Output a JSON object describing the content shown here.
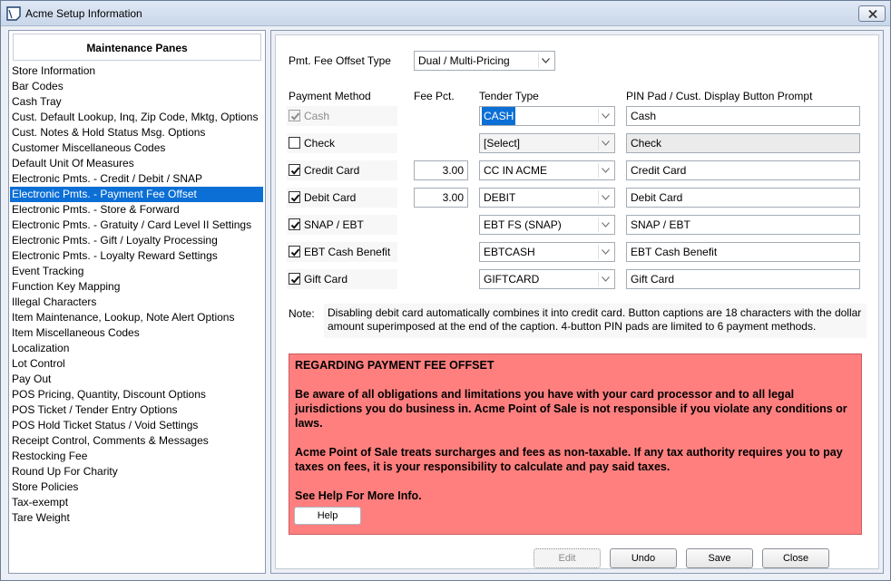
{
  "window": {
    "title": "Acme Setup Information"
  },
  "left_panel": {
    "header": "Maintenance Panes",
    "items": [
      "Store Information",
      "Bar Codes",
      "Cash Tray",
      "Cust. Default Lookup, Inq, Zip Code, Mktg, Options",
      "Cust. Notes & Hold Status Msg. Options",
      "Customer Miscellaneous Codes",
      "Default Unit Of Measures",
      "Electronic Pmts. - Credit / Debit / SNAP",
      "Electronic Pmts. - Payment Fee Offset",
      "Electronic Pmts. - Store & Forward",
      "Electronic Pmts. - Gratuity / Card Level II Settings",
      "Electronic Pmts. - Gift / Loyalty Processing",
      "Electronic Pmts. - Loyalty Reward Settings",
      "Event Tracking",
      "Function Key Mapping",
      "Illegal Characters",
      "Item Maintenance, Lookup, Note Alert Options",
      "Item Miscellaneous Codes",
      "Localization",
      "Lot Control",
      "Pay Out",
      "POS Pricing, Quantity, Discount Options",
      "POS Ticket / Tender Entry Options",
      "POS Hold Ticket Status / Void Settings",
      "Receipt Control, Comments & Messages",
      "Restocking Fee",
      "Round Up For Charity",
      "Store Policies",
      "Tax-exempt",
      "Tare Weight"
    ],
    "selected_index": 8
  },
  "form": {
    "offset_type_label": "Pmt. Fee Offset Type",
    "offset_type_value": "Dual / Multi-Pricing",
    "col_payment_method": "Payment Method",
    "col_fee_pct": "Fee Pct.",
    "col_tender_type": "Tender Type",
    "col_prompt": "PIN Pad / Cust. Display Button Prompt",
    "rows": [
      {
        "method": "Cash",
        "checked": true,
        "disabled": true,
        "fee": "",
        "tender": "CASH",
        "prompt": "Cash"
      },
      {
        "method": "Check",
        "checked": false,
        "disabled": false,
        "fee": "",
        "tender": "[Select]",
        "prompt": "Check"
      },
      {
        "method": "Credit Card",
        "checked": true,
        "disabled": false,
        "fee": "3.00",
        "tender": "CC  IN ACME",
        "prompt": "Credit Card"
      },
      {
        "method": "Debit Card",
        "checked": true,
        "disabled": false,
        "fee": "3.00",
        "tender": "DEBIT",
        "prompt": "Debit Card"
      },
      {
        "method": "SNAP / EBT",
        "checked": true,
        "disabled": false,
        "fee": "",
        "tender": "EBT FS (SNAP)",
        "prompt": "SNAP / EBT"
      },
      {
        "method": "EBT Cash Benefit",
        "checked": true,
        "disabled": false,
        "fee": "",
        "tender": "EBTCASH",
        "prompt": "EBT Cash Benefit"
      },
      {
        "method": "Gift Card",
        "checked": true,
        "disabled": false,
        "fee": "",
        "tender": "GIFTCARD",
        "prompt": "Gift Card"
      }
    ],
    "note_label": "Note:",
    "note_text": "Disabling debit card automatically combines it into credit card. Button captions are 18 characters with the dollar amount superimposed at the end of the caption. 4-button PIN pads are limited to 6 payment methods."
  },
  "alert": {
    "title": "REGARDING PAYMENT FEE OFFSET",
    "para1": "Be aware of all obligations and limitations you have with your card processor and to all legal jurisdictions you do business in. Acme Point of Sale is not responsible if you violate any conditions or laws.",
    "para2": "Acme Point of Sale treats surcharges and fees as non-taxable. If any tax authority requires you to pay taxes on fees, it is your responsibility to calculate and pay said taxes.",
    "para3": "See Help For More Info.",
    "help_button": "Help",
    "color": "#ff7f7f"
  },
  "buttons": {
    "edit": "Edit",
    "undo": "Undo",
    "save": "Save",
    "close": "Close"
  },
  "colors": {
    "selection": "#0b6fd6",
    "alert_bg": "#ff7f7f"
  }
}
